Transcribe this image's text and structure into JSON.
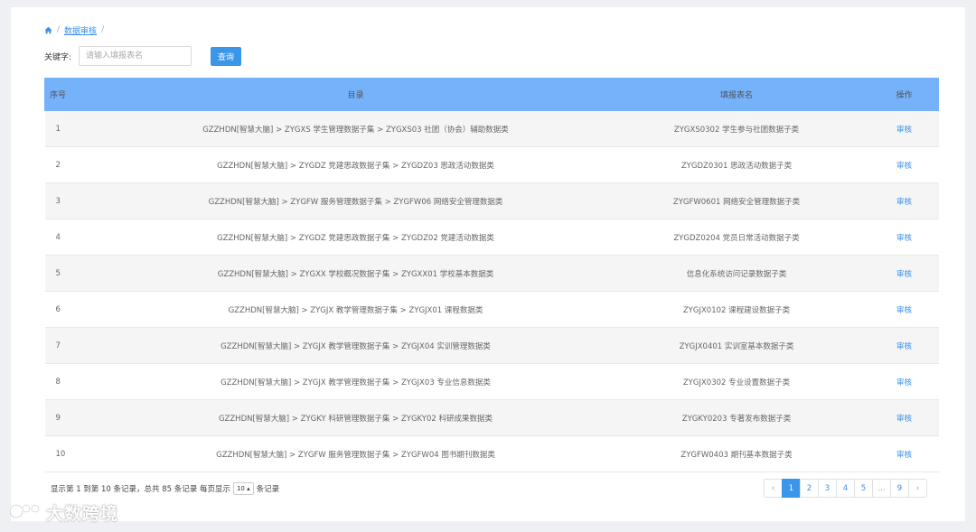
{
  "breadcrumb": {
    "home_icon": "home-icon",
    "current": "数据审核",
    "separator": "/"
  },
  "search": {
    "label": "关键字:",
    "placeholder": "请输入填报表名",
    "button_label": "查询"
  },
  "table": {
    "headers": {
      "no": "序号",
      "directory": "目录",
      "form_name": "填报表名",
      "operation": "操作"
    },
    "rows": [
      {
        "no": "1",
        "directory": "GZZHDN[智慧大脑] > ZYGXS 学生管理数据子集 > ZYGXS03 社团（协会）辅助数据类",
        "form_name": "ZYGXS0302 学生参与社团数据子类",
        "action": "审核"
      },
      {
        "no": "2",
        "directory": "GZZHDN[智慧大脑] > ZYGDZ 党建思政数据子集 > ZYGDZ03 思政活动数据类",
        "form_name": "ZYGDZ0301 思政活动数据子类",
        "action": "审核"
      },
      {
        "no": "3",
        "directory": "GZZHDN[智慧大脑] > ZYGFW 服务管理数据子集 > ZYGFW06 网络安全管理数据类",
        "form_name": "ZYGFW0601 网络安全管理数据子类",
        "action": "审核"
      },
      {
        "no": "4",
        "directory": "GZZHDN[智慧大脑] > ZYGDZ 党建思政数据子集 > ZYGDZ02 党建活动数据类",
        "form_name": "ZYGDZ0204 党员日常活动数据子类",
        "action": "审核"
      },
      {
        "no": "5",
        "directory": "GZZHDN[智慧大脑] > ZYGXX 学校概况数据子集 > ZYGXX01 学校基本数据类",
        "form_name": "信息化系统访问记录数据子类",
        "action": "审核"
      },
      {
        "no": "6",
        "directory": "GZZHDN[智慧大脑] > ZYGJX 教学管理数据子集 > ZYGJX01 课程数据类",
        "form_name": "ZYGJX0102 课程建设数据子类",
        "action": "审核"
      },
      {
        "no": "7",
        "directory": "GZZHDN[智慧大脑] > ZYGJX 教学管理数据子集 > ZYGJX04 实训管理数据类",
        "form_name": "ZYGJX0401 实训室基本数据子类",
        "action": "审核"
      },
      {
        "no": "8",
        "directory": "GZZHDN[智慧大脑] > ZYGJX 教学管理数据子集 > ZYGJX03 专业信息数据类",
        "form_name": "ZYGJX0302 专业设置数据子类",
        "action": "审核"
      },
      {
        "no": "9",
        "directory": "GZZHDN[智慧大脑] > ZYGKY 科研管理数据子集 > ZYGKY02 科研成果数据类",
        "form_name": "ZYGKY0203 专著发布数据子类",
        "action": "审核"
      },
      {
        "no": "10",
        "directory": "GZZHDN[智慧大脑] > ZYGFW 服务管理数据子集 > ZYGFW04 图书期刊数据类",
        "form_name": "ZYGFW0403 期刊基本数据子类",
        "action": "审核"
      }
    ]
  },
  "footer": {
    "info_prefix": "显示第 1 到第 10 条记录，总共 85 条记录 每页显示",
    "page_size": "10 ▴",
    "info_suffix": "条记录"
  },
  "pagination": {
    "prev": "‹",
    "pages": [
      "1",
      "2",
      "3",
      "4",
      "5",
      "...",
      "9"
    ],
    "current": "1",
    "next": "›"
  },
  "watermark": {
    "text": "大数跨境",
    "logo_icon": "watermark-logo-icon"
  },
  "colors": {
    "accent": "#3b95e8",
    "table_header": "#76b2f9",
    "link": "#3a8ee6",
    "row_stripe": "#f5f5f5"
  }
}
